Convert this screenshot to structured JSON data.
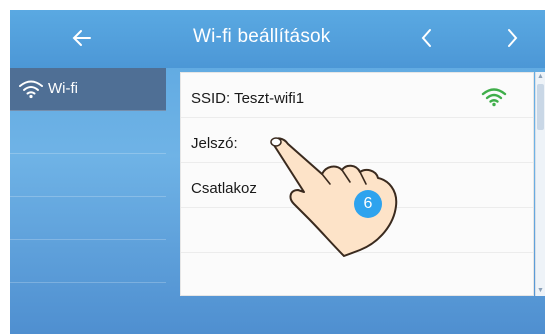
{
  "header": {
    "title": "Wi-fi beállítások",
    "back_icon": "arrow-left-icon",
    "prev_icon": "chevron-left-icon",
    "next_icon": "chevron-right-icon"
  },
  "sidebar": {
    "items": [
      {
        "label": "Wi-fi",
        "icon": "wifi-icon",
        "active": true
      }
    ]
  },
  "panel": {
    "rows": [
      {
        "text": "SSID: Teszt-wifi1",
        "icon": "wifi-signal-icon"
      },
      {
        "text": "Jelszó:"
      },
      {
        "text": "Csatlakozás indítás",
        "visible_text": "Csatlakoz            nt"
      }
    ]
  },
  "overlay": {
    "step_badge": "6",
    "hand_icon": "pointing-hand-icon"
  },
  "colors": {
    "header_bg": "#4c97d6",
    "sidebar_active": "#4f6f95",
    "signal_green": "#3fae4a",
    "badge": "#2ea3ee"
  }
}
